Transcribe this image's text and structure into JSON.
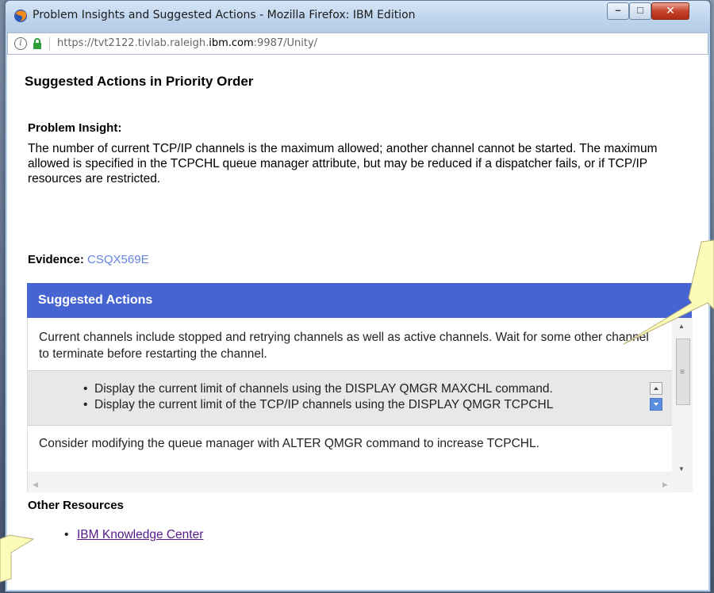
{
  "window": {
    "title": "Problem Insights and Suggested Actions - Mozilla Firefox: IBM Edition",
    "controls": {
      "minimize": "–",
      "maximize": "□",
      "close": "✕"
    }
  },
  "address_bar": {
    "url_prefix": "https://tvt2122.tivlab.raleigh.",
    "url_domain": "ibm.com",
    "url_suffix": ":9987/Unity/",
    "info_icon": "i"
  },
  "page": {
    "title": "Suggested Actions in Priority Order",
    "insight_label": "Problem Insight:",
    "insight_text": "The number of current TCP/IP channels is the maximum allowed; another channel cannot be started. The maximum allowed is specified in the TCPCHL queue manager attribute, but may be reduced if a dispatcher fails, or if TCP/IP resources are restricted.",
    "evidence_label": "Evidence:",
    "evidence_link": "CSQX569E",
    "suggested_actions": {
      "header": "Suggested Actions",
      "para1": "Current channels include stopped and retrying channels as well as active channels. Wait for some other channel to terminate before restarting the channel.",
      "bullets": [
        "Display the current limit of channels using the DISPLAY QMGR MAXCHL command.",
        "Display the current limit of the TCP/IP channels using the DISPLAY QMGR TCPCHL"
      ],
      "para3": "Consider modifying the queue manager with ALTER QMGR command to increase TCPCHL."
    },
    "other_resources_label": "Other Resources",
    "resources": [
      "IBM Knowledge Center"
    ]
  },
  "colors": {
    "header_blue": "#4664d2",
    "link_blue": "#6584e0",
    "visited_link": "#551a8b",
    "callout_yellow": "#fdfbb8"
  }
}
